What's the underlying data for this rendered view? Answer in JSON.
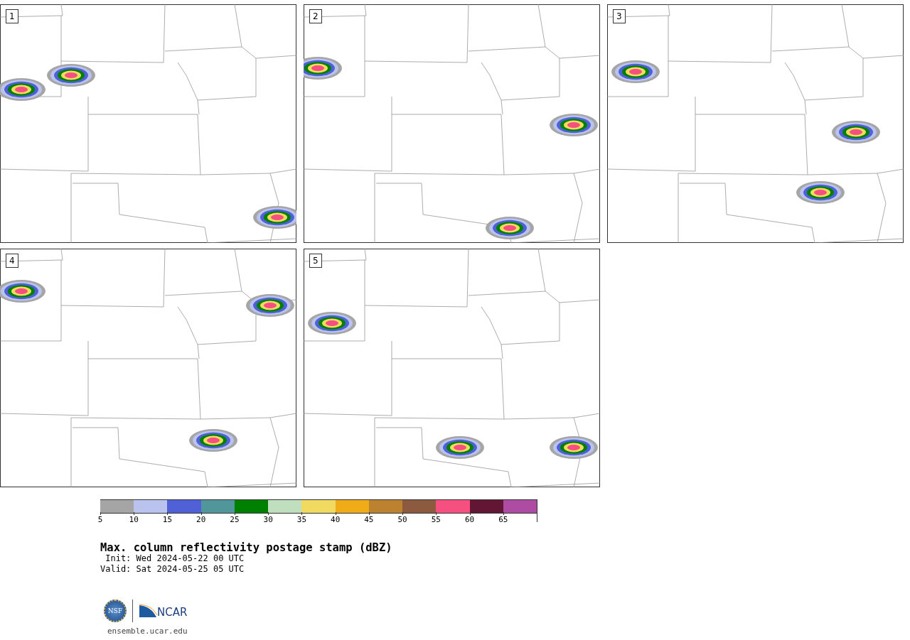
{
  "panels": [
    {
      "label": "1"
    },
    {
      "label": "2"
    },
    {
      "label": "3"
    },
    {
      "label": "4"
    },
    {
      "label": "5"
    }
  ],
  "colorbar": {
    "segments": [
      {
        "color": "#a5a5a5",
        "tick": "5"
      },
      {
        "color": "#b9c3ed",
        "tick": "10"
      },
      {
        "color": "#5060d6",
        "tick": "15"
      },
      {
        "color": "#50969a",
        "tick": "20"
      },
      {
        "color": "#008000",
        "tick": "25"
      },
      {
        "color": "#c0dfbe",
        "tick": "30"
      },
      {
        "color": "#f0da60",
        "tick": "35"
      },
      {
        "color": "#f0ac18",
        "tick": "40"
      },
      {
        "color": "#bc8230",
        "tick": "45"
      },
      {
        "color": "#8c5a3e",
        "tick": "50"
      },
      {
        "color": "#f65080",
        "tick": "55"
      },
      {
        "color": "#621634",
        "tick": "60"
      },
      {
        "color": "#ae4ba2",
        "tick": "65"
      }
    ]
  },
  "title": "Max. column reflectivity postage stamp (dBZ)",
  "init": " Init: Wed 2024-05-22 00 UTC",
  "valid": "Valid: Sat 2024-05-25 05 UTC",
  "logos": {
    "nsf": "NSF",
    "ncar": "NCAR"
  },
  "url": "ensemble.ucar.edu"
}
